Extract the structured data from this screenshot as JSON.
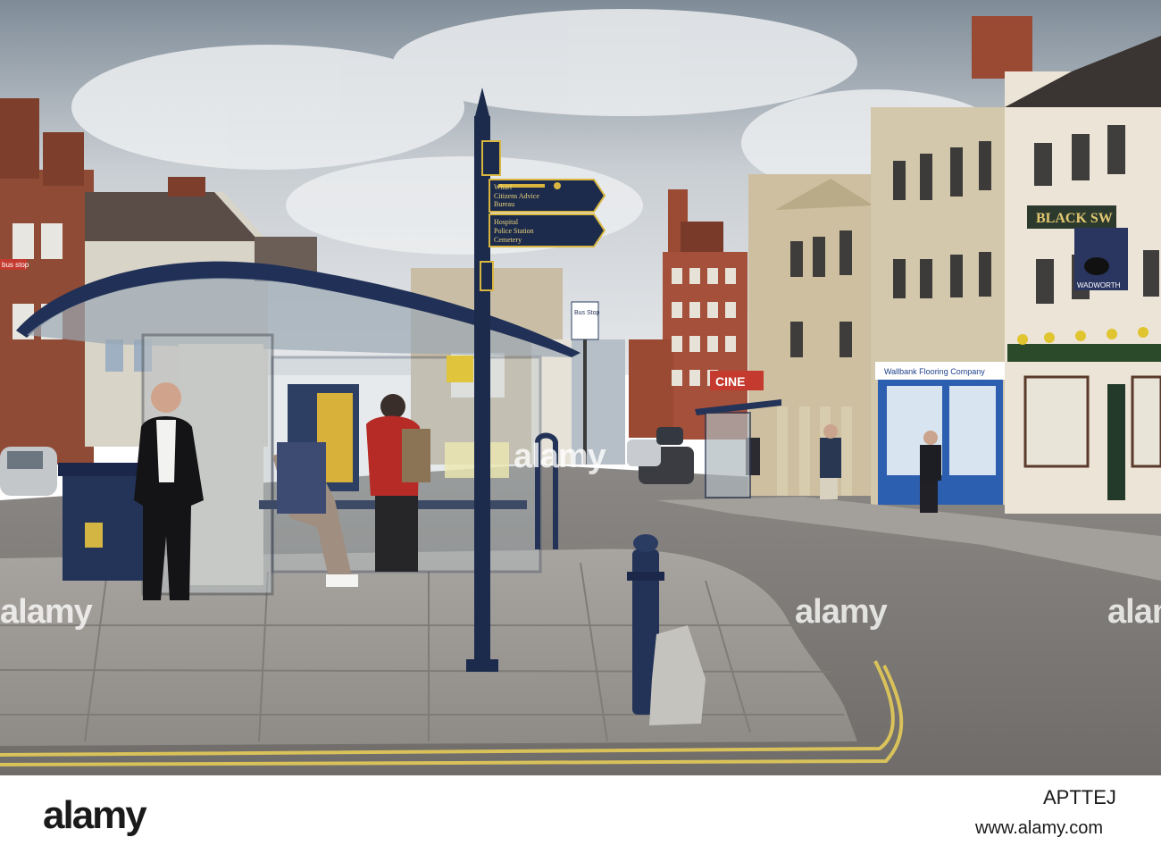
{
  "photo": {
    "signpost": {
      "line1": "Wharf",
      "line2": "Citizens Advice",
      "line3": "Bureau",
      "line4": "Hospital",
      "line5": "Police Station",
      "line6": "Cemetery"
    },
    "shop_fascia": "Wallbank Flooring Company",
    "pub_sign_text": "BLACK SW",
    "pub_board_text": "WADWORTH",
    "bus_stop_sign": "Bus Stop",
    "left_bus_stop_sign": "bus stop",
    "cinema_sign": "CINE",
    "watermarks": [
      "alamy",
      "alamy",
      "alamy",
      "alamy"
    ]
  },
  "footer": {
    "logo": "alamy",
    "image_id": "APTTEJ",
    "url": "www.alamy.com"
  },
  "colors": {
    "sky": "#b9c1c8",
    "brick": "#8f4b36",
    "sign_blue": "#1c2a4c",
    "sign_gold": "#d8b640",
    "road": "#7b7874",
    "pavement": "#9d9a95"
  }
}
